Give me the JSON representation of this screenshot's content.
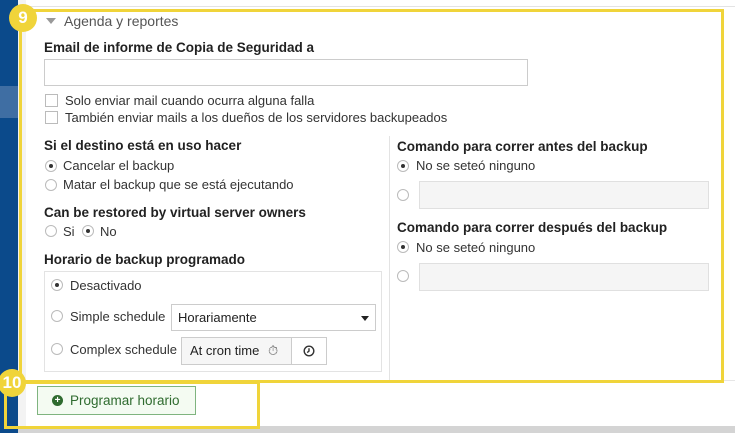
{
  "section": {
    "title": "Agenda y reportes"
  },
  "email": {
    "label": "Email de informe de Copia de Seguridad a",
    "value": "",
    "option_failure_only": "Solo enviar mail cuando ocurra alguna falla",
    "option_notify_owners": "También enviar mails a los dueños de los servidores backupeados"
  },
  "in_use": {
    "label": "Si el destino está en uso hacer",
    "options": [
      "Cancelar el backup",
      "Matar el backup que se está ejecutando"
    ],
    "selected": 0
  },
  "restore": {
    "label": "Can be restored by virtual server owners",
    "yes": "Si",
    "no": "No",
    "selected": "no"
  },
  "schedule": {
    "label": "Horario de backup programado",
    "disabled": "Desactivado",
    "simple": "Simple schedule",
    "complex": "Complex schedule",
    "simple_value": "Horariamente",
    "cron_value": "At cron time",
    "selected": "disabled"
  },
  "cmd_before": {
    "label": "Comando para correr antes del backup",
    "none": "No se seteó ninguno",
    "value": ""
  },
  "cmd_after": {
    "label": "Comando para correr después del backup",
    "none": "No se seteó ninguno",
    "value": ""
  },
  "actions": {
    "schedule_button": "Programar horario"
  },
  "annotations": {
    "box_9": "9",
    "box_10": "10"
  },
  "colors": {
    "highlight": "#f0d43a",
    "sidebar": "#0b4a8b",
    "button_green": "#2f6b2f"
  }
}
